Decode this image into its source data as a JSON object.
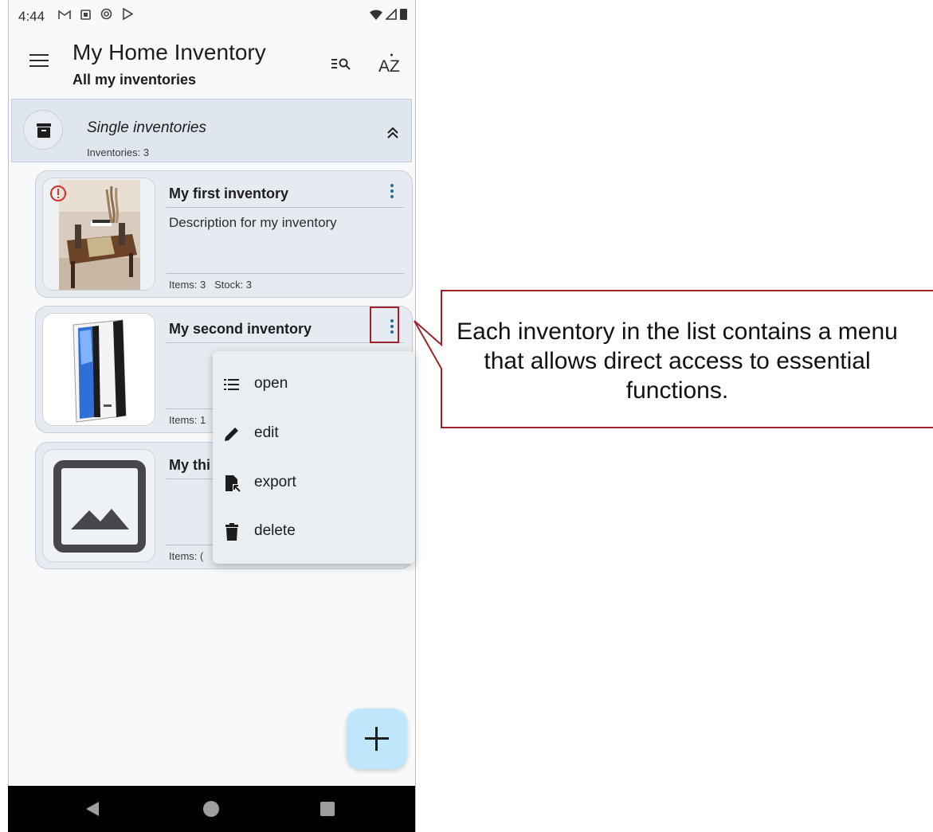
{
  "status_bar": {
    "time": "4:44",
    "notification_icons": [
      "gmail-icon",
      "calendar-icon",
      "at-sign-icon",
      "play-store-icon"
    ],
    "system_icons": [
      "wifi-icon",
      "signal-icon",
      "battery-icon"
    ]
  },
  "app_bar": {
    "title": "My Home Inventory",
    "subtitle": "All my inventories"
  },
  "group": {
    "title": "Single inventories",
    "count_label": "Inventories: 3"
  },
  "inventories": [
    {
      "title": "My first inventory",
      "description": "Description for my inventory",
      "stats": "Items: 3   Stock: 3",
      "warning": true
    },
    {
      "title": "My second inventory",
      "description": "",
      "stats": "Items: 1",
      "warning": false
    },
    {
      "title": "My thi",
      "description": "",
      "stats": "Items: (",
      "warning": false
    }
  ],
  "popup_menu": {
    "items": [
      {
        "label": "open",
        "icon": "list-icon"
      },
      {
        "label": "edit",
        "icon": "pencil-icon"
      },
      {
        "label": "export",
        "icon": "file-export-icon"
      },
      {
        "label": "delete",
        "icon": "trash-icon"
      }
    ]
  },
  "callout": {
    "text": "Each inventory in the list contains a menu that allows direct access to essential functions."
  },
  "colors": {
    "accent": "#1f6f94",
    "fab": "#bfe6fb",
    "highlight_border": "#a0222b",
    "warning": "#d32f2f"
  }
}
